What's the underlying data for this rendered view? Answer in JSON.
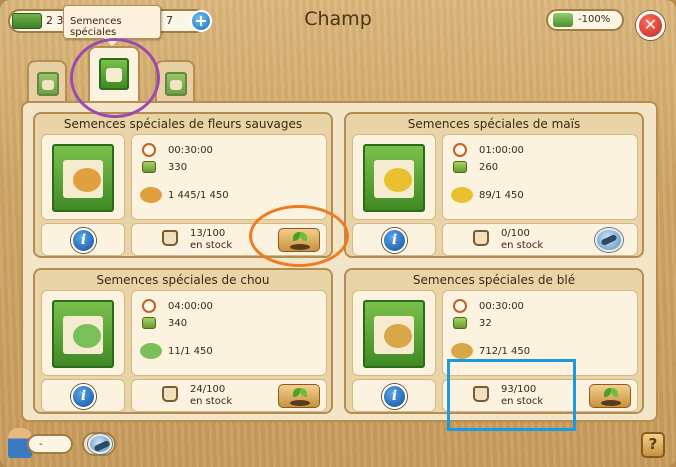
{
  "window": {
    "title": "Champ"
  },
  "topbar": {
    "currency_left": "2 3",
    "currency_right": "7",
    "tooltip": "Semences spéciales",
    "speed": "-100%",
    "plus_icon": "plus-icon",
    "close_icon": "close-icon"
  },
  "tabs": [
    {
      "name": "field-tab",
      "icon": "seed-bag-icon",
      "active": false
    },
    {
      "name": "special-seeds-tab",
      "icon": "special-seed-bag-icon",
      "active": true
    },
    {
      "name": "timed-tab",
      "icon": "timer-seed-bag-icon",
      "active": false
    }
  ],
  "cards": [
    {
      "title": "Semences spéciales de fleurs sauvages",
      "time": "00:30:00",
      "xp": "330",
      "progress": "1 445/1 450",
      "stock_count": "13/100",
      "stock_label": "en stock",
      "action": "plant",
      "crop": "wildflowers",
      "color": "#e0a040"
    },
    {
      "title": "Semences spéciales de maïs",
      "time": "01:00:00",
      "xp": "260",
      "progress": "89/1 450",
      "stock_count": "0/100",
      "stock_label": "en stock",
      "action": "boost",
      "crop": "corn",
      "color": "#e8c030"
    },
    {
      "title": "Semences spéciales de chou",
      "time": "04:00:00",
      "xp": "340",
      "progress": "11/1 450",
      "stock_count": "24/100",
      "stock_label": "en stock",
      "action": "plant",
      "crop": "cabbage",
      "color": "#7ac05a"
    },
    {
      "title": "Semences spéciales de blé",
      "time": "00:30:00",
      "xp": "32",
      "progress": "712/1 450",
      "stock_count": "93/100",
      "stock_label": "en stock",
      "action": "plant",
      "crop": "wheat",
      "color": "#d8a848"
    }
  ],
  "bottombar": {
    "farmer_value": "-",
    "help_label": "?"
  }
}
